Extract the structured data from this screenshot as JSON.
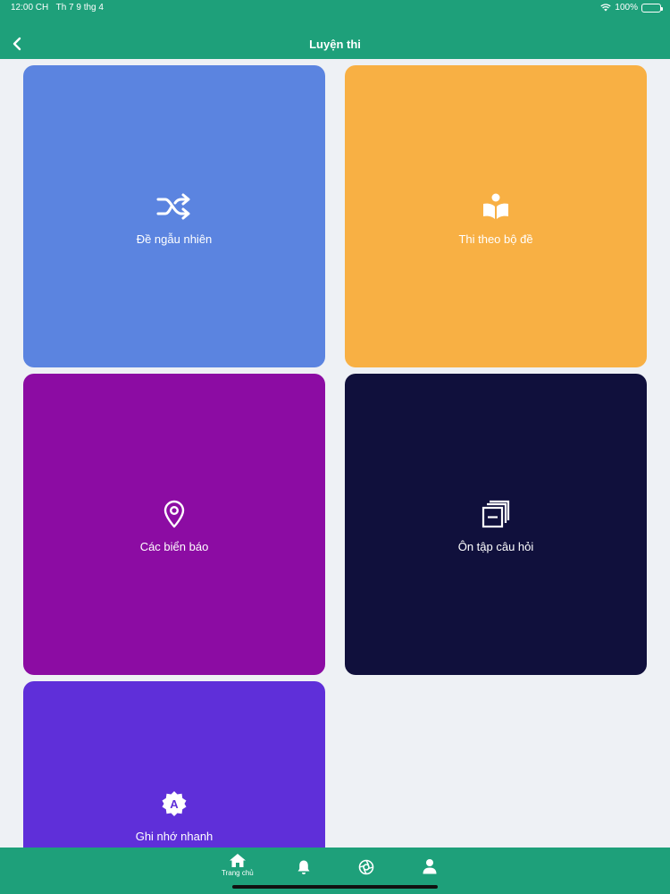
{
  "status_bar": {
    "time": "12:00 CH",
    "date": "Th 7 9 thg 4",
    "battery": "100%"
  },
  "header": {
    "title": "Luyện thi",
    "back_icon": "chevron-left-icon"
  },
  "cards": [
    {
      "label": "Đề ngẫu nhiên",
      "icon": "shuffle-icon",
      "color": "#5b84e0"
    },
    {
      "label": "Thi theo bộ đề",
      "icon": "book-reader-icon",
      "color": "#f8b044"
    },
    {
      "label": "Các biển báo",
      "icon": "map-pin-icon",
      "color": "#8c0ca3"
    },
    {
      "label": "Ôn tập câu hỏi",
      "icon": "stacked-cards-icon",
      "color": "#10103c"
    },
    {
      "label": "Ghi nhớ nhanh",
      "icon": "badge-a-icon",
      "color": "#5f2fd9"
    }
  ],
  "tabbar": {
    "items": [
      {
        "label": "Trang chủ",
        "icon": "home-icon"
      },
      {
        "label": "",
        "icon": "bell-icon"
      },
      {
        "label": "",
        "icon": "aperture-icon"
      },
      {
        "label": "",
        "icon": "user-icon"
      }
    ]
  }
}
